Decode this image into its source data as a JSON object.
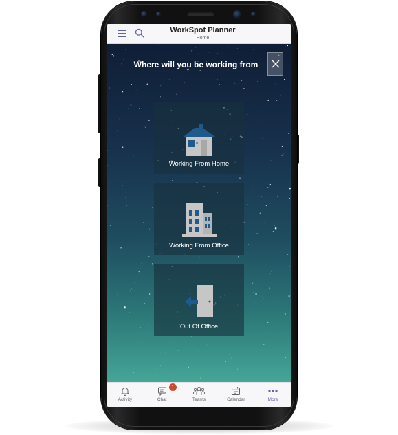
{
  "app": {
    "title": "WorkSpot Planner",
    "subtitle": "Home"
  },
  "hero": {
    "prompt": "Where will you be working from"
  },
  "options": [
    {
      "label": "Working From Home",
      "icon": "house-icon"
    },
    {
      "label": "Working From Office",
      "icon": "office-building-icon"
    },
    {
      "label": "Out Of Office",
      "icon": "door-exit-icon"
    }
  ],
  "tabs": [
    {
      "label": "Activity",
      "icon": "bell-icon"
    },
    {
      "label": "Chat",
      "icon": "chat-icon",
      "badge": "1"
    },
    {
      "label": "Teams",
      "icon": "teams-icon"
    },
    {
      "label": "Calendar",
      "icon": "calendar-icon"
    },
    {
      "label": "More",
      "icon": "more-icon",
      "active": true
    }
  ],
  "colors": {
    "accent": "#6264a7",
    "badge": "#cc4a31",
    "sky_top": "#101e36",
    "sky_bottom": "#44a697",
    "icon_blue": "#1f5a8c",
    "icon_gray": "#c6c6c6"
  }
}
